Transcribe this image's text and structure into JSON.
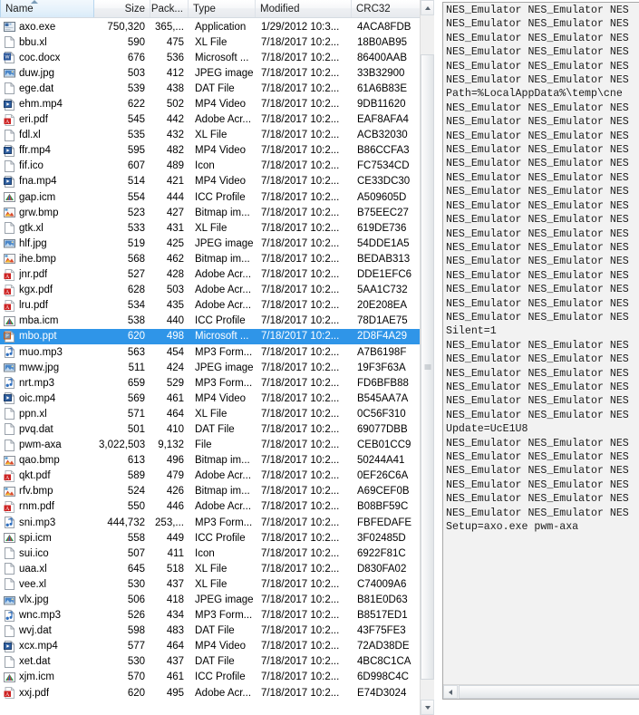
{
  "file_list": {
    "columns": [
      {
        "key": "name",
        "label": "Name",
        "sorted": true,
        "sort_dir": "asc"
      },
      {
        "key": "size",
        "label": "Size"
      },
      {
        "key": "packed",
        "label": "Pack..."
      },
      {
        "key": "type",
        "label": "Type"
      },
      {
        "key": "modified",
        "label": "Modified"
      },
      {
        "key": "crc32",
        "label": "CRC32"
      }
    ],
    "rows": [
      {
        "icon": "exe-icon",
        "name": "axo.exe",
        "size": "750,320",
        "packed": "365,...",
        "type": "Application",
        "modified": "1/29/2012 10:3...",
        "crc32": "4ACA8FDB",
        "selected": false
      },
      {
        "icon": "blank-icon",
        "name": "bbu.xl",
        "size": "590",
        "packed": "475",
        "type": "XL File",
        "modified": "7/18/2017 10:2...",
        "crc32": "18B0AB95",
        "selected": false
      },
      {
        "icon": "word-icon",
        "name": "coc.docx",
        "size": "676",
        "packed": "536",
        "type": "Microsoft ...",
        "modified": "7/18/2017 10:2...",
        "crc32": "86400AAB",
        "selected": false
      },
      {
        "icon": "image-icon",
        "name": "duw.jpg",
        "size": "503",
        "packed": "412",
        "type": "JPEG image",
        "modified": "7/18/2017 10:2...",
        "crc32": "33B32900",
        "selected": false
      },
      {
        "icon": "blank-icon",
        "name": "ege.dat",
        "size": "539",
        "packed": "438",
        "type": "DAT File",
        "modified": "7/18/2017 10:2...",
        "crc32": "61A6B83E",
        "selected": false
      },
      {
        "icon": "video-icon",
        "name": "ehm.mp4",
        "size": "622",
        "packed": "502",
        "type": "MP4 Video",
        "modified": "7/18/2017 10:2...",
        "crc32": "9DB11620",
        "selected": false
      },
      {
        "icon": "pdf-icon",
        "name": "eri.pdf",
        "size": "545",
        "packed": "442",
        "type": "Adobe Acr...",
        "modified": "7/18/2017 10:2...",
        "crc32": "EAF8AFA4",
        "selected": false
      },
      {
        "icon": "blank-icon",
        "name": "fdl.xl",
        "size": "535",
        "packed": "432",
        "type": "XL File",
        "modified": "7/18/2017 10:2...",
        "crc32": "ACB32030",
        "selected": false
      },
      {
        "icon": "video-icon",
        "name": "ffr.mp4",
        "size": "595",
        "packed": "482",
        "type": "MP4 Video",
        "modified": "7/18/2017 10:2...",
        "crc32": "B86CCFA3",
        "selected": false
      },
      {
        "icon": "blank-icon",
        "name": "fif.ico",
        "size": "607",
        "packed": "489",
        "type": "Icon",
        "modified": "7/18/2017 10:2...",
        "crc32": "FC7534CD",
        "selected": false
      },
      {
        "icon": "video-icon",
        "name": "fna.mp4",
        "size": "514",
        "packed": "421",
        "type": "MP4 Video",
        "modified": "7/18/2017 10:2...",
        "crc32": "CE33DC30",
        "selected": false
      },
      {
        "icon": "icc-icon",
        "name": "gap.icm",
        "size": "554",
        "packed": "444",
        "type": "ICC Profile",
        "modified": "7/18/2017 10:2...",
        "crc32": "A509605D",
        "selected": false
      },
      {
        "icon": "bitmap-icon",
        "name": "grw.bmp",
        "size": "523",
        "packed": "427",
        "type": "Bitmap im...",
        "modified": "7/18/2017 10:2...",
        "crc32": "B75EEC27",
        "selected": false
      },
      {
        "icon": "blank-icon",
        "name": "gtk.xl",
        "size": "533",
        "packed": "431",
        "type": "XL File",
        "modified": "7/18/2017 10:2...",
        "crc32": "619DE736",
        "selected": false
      },
      {
        "icon": "image-icon",
        "name": "hlf.jpg",
        "size": "519",
        "packed": "425",
        "type": "JPEG image",
        "modified": "7/18/2017 10:2...",
        "crc32": "54DDE1A5",
        "selected": false
      },
      {
        "icon": "bitmap-icon",
        "name": "ihe.bmp",
        "size": "568",
        "packed": "462",
        "type": "Bitmap im...",
        "modified": "7/18/2017 10:2...",
        "crc32": "BEDAB313",
        "selected": false
      },
      {
        "icon": "pdf-icon",
        "name": "jnr.pdf",
        "size": "527",
        "packed": "428",
        "type": "Adobe Acr...",
        "modified": "7/18/2017 10:2...",
        "crc32": "DDE1EFC6",
        "selected": false
      },
      {
        "icon": "pdf-icon",
        "name": "kgx.pdf",
        "size": "628",
        "packed": "503",
        "type": "Adobe Acr...",
        "modified": "7/18/2017 10:2...",
        "crc32": "5AA1C732",
        "selected": false
      },
      {
        "icon": "pdf-icon",
        "name": "lru.pdf",
        "size": "534",
        "packed": "435",
        "type": "Adobe Acr...",
        "modified": "7/18/2017 10:2...",
        "crc32": "20E208EA",
        "selected": false
      },
      {
        "icon": "icc-icon",
        "name": "mba.icm",
        "size": "538",
        "packed": "440",
        "type": "ICC Profile",
        "modified": "7/18/2017 10:2...",
        "crc32": "78D1AE75",
        "selected": false
      },
      {
        "icon": "ppt-icon",
        "name": "mbo.ppt",
        "size": "620",
        "packed": "498",
        "type": "Microsoft ...",
        "modified": "7/18/2017 10:2...",
        "crc32": "2D8F4A29",
        "selected": true
      },
      {
        "icon": "audio-icon",
        "name": "muo.mp3",
        "size": "563",
        "packed": "454",
        "type": "MP3 Form...",
        "modified": "7/18/2017 10:2...",
        "crc32": "A7B6198F",
        "selected": false
      },
      {
        "icon": "image-icon",
        "name": "mww.jpg",
        "size": "511",
        "packed": "424",
        "type": "JPEG image",
        "modified": "7/18/2017 10:2...",
        "crc32": "19F3F63A",
        "selected": false
      },
      {
        "icon": "audio-icon",
        "name": "nrt.mp3",
        "size": "659",
        "packed": "529",
        "type": "MP3 Form...",
        "modified": "7/18/2017 10:2...",
        "crc32": "FD6BFB88",
        "selected": false
      },
      {
        "icon": "video-icon",
        "name": "oic.mp4",
        "size": "569",
        "packed": "461",
        "type": "MP4 Video",
        "modified": "7/18/2017 10:2...",
        "crc32": "B545AA7A",
        "selected": false
      },
      {
        "icon": "blank-icon",
        "name": "ppn.xl",
        "size": "571",
        "packed": "464",
        "type": "XL File",
        "modified": "7/18/2017 10:2...",
        "crc32": "0C56F310",
        "selected": false
      },
      {
        "icon": "blank-icon",
        "name": "pvq.dat",
        "size": "501",
        "packed": "410",
        "type": "DAT File",
        "modified": "7/18/2017 10:2...",
        "crc32": "69077DBB",
        "selected": false
      },
      {
        "icon": "blank-icon",
        "name": "pwm-axa",
        "size": "3,022,503",
        "packed": "9,132",
        "type": "File",
        "modified": "7/18/2017 10:2...",
        "crc32": "CEB01CC9",
        "selected": false
      },
      {
        "icon": "bitmap-icon",
        "name": "qao.bmp",
        "size": "613",
        "packed": "496",
        "type": "Bitmap im...",
        "modified": "7/18/2017 10:2...",
        "crc32": "50244A41",
        "selected": false
      },
      {
        "icon": "pdf-icon",
        "name": "qkt.pdf",
        "size": "589",
        "packed": "479",
        "type": "Adobe Acr...",
        "modified": "7/18/2017 10:2...",
        "crc32": "0EF26C6A",
        "selected": false
      },
      {
        "icon": "bitmap-icon",
        "name": "rfv.bmp",
        "size": "524",
        "packed": "426",
        "type": "Bitmap im...",
        "modified": "7/18/2017 10:2...",
        "crc32": "A69CEF0B",
        "selected": false
      },
      {
        "icon": "pdf-icon",
        "name": "rnm.pdf",
        "size": "550",
        "packed": "446",
        "type": "Adobe Acr...",
        "modified": "7/18/2017 10:2...",
        "crc32": "B08BF59C",
        "selected": false
      },
      {
        "icon": "audio-icon",
        "name": "sni.mp3",
        "size": "444,732",
        "packed": "253,...",
        "type": "MP3 Form...",
        "modified": "7/18/2017 10:2...",
        "crc32": "FBFEDAFE",
        "selected": false
      },
      {
        "icon": "icc-icon",
        "name": "spi.icm",
        "size": "558",
        "packed": "449",
        "type": "ICC Profile",
        "modified": "7/18/2017 10:2...",
        "crc32": "3F02485D",
        "selected": false
      },
      {
        "icon": "blank-icon",
        "name": "sui.ico",
        "size": "507",
        "packed": "411",
        "type": "Icon",
        "modified": "7/18/2017 10:2...",
        "crc32": "6922F81C",
        "selected": false
      },
      {
        "icon": "blank-icon",
        "name": "uaa.xl",
        "size": "645",
        "packed": "518",
        "type": "XL File",
        "modified": "7/18/2017 10:2...",
        "crc32": "D830FA02",
        "selected": false
      },
      {
        "icon": "blank-icon",
        "name": "vee.xl",
        "size": "530",
        "packed": "437",
        "type": "XL File",
        "modified": "7/18/2017 10:2...",
        "crc32": "C74009A6",
        "selected": false
      },
      {
        "icon": "image-icon",
        "name": "vlx.jpg",
        "size": "506",
        "packed": "418",
        "type": "JPEG image",
        "modified": "7/18/2017 10:2...",
        "crc32": "B81E0D63",
        "selected": false
      },
      {
        "icon": "audio-icon",
        "name": "wnc.mp3",
        "size": "526",
        "packed": "434",
        "type": "MP3 Form...",
        "modified": "7/18/2017 10:2...",
        "crc32": "B8517ED1",
        "selected": false
      },
      {
        "icon": "blank-icon",
        "name": "wvj.dat",
        "size": "598",
        "packed": "483",
        "type": "DAT File",
        "modified": "7/18/2017 10:2...",
        "crc32": "43F75FE3",
        "selected": false
      },
      {
        "icon": "video-icon",
        "name": "xcx.mp4",
        "size": "577",
        "packed": "464",
        "type": "MP4 Video",
        "modified": "7/18/2017 10:2...",
        "crc32": "72AD38DE",
        "selected": false
      },
      {
        "icon": "blank-icon",
        "name": "xet.dat",
        "size": "530",
        "packed": "437",
        "type": "DAT File",
        "modified": "7/18/2017 10:2...",
        "crc32": "4BC8C1CA",
        "selected": false
      },
      {
        "icon": "icc-icon",
        "name": "xjm.icm",
        "size": "570",
        "packed": "461",
        "type": "ICC Profile",
        "modified": "7/18/2017 10:2...",
        "crc32": "6D998C4C",
        "selected": false
      },
      {
        "icon": "pdf-icon",
        "name": "xxj.pdf",
        "size": "620",
        "packed": "495",
        "type": "Adobe Acr...",
        "modified": "7/18/2017 10:2...",
        "crc32": "E74D3024",
        "selected": false
      }
    ]
  },
  "text_view": {
    "filler_line": "NES_Emulator NES_Emulator NES",
    "lines": [
      "NES_Emulator NES_Emulator NES",
      "NES_Emulator NES_Emulator NES",
      "NES_Emulator NES_Emulator NES",
      "NES_Emulator NES_Emulator NES",
      "NES_Emulator NES_Emulator NES",
      "NES_Emulator NES_Emulator NES",
      "Path=%LocalAppData%\\temp\\cne",
      "NES_Emulator NES_Emulator NES",
      "NES_Emulator NES_Emulator NES",
      "NES_Emulator NES_Emulator NES",
      "NES_Emulator NES_Emulator NES",
      "NES_Emulator NES_Emulator NES",
      "NES_Emulator NES_Emulator NES",
      "NES_Emulator NES_Emulator NES",
      "NES_Emulator NES_Emulator NES",
      "NES_Emulator NES_Emulator NES",
      "NES_Emulator NES_Emulator NES",
      "NES_Emulator NES_Emulator NES",
      "NES_Emulator NES_Emulator NES",
      "NES_Emulator NES_Emulator NES",
      "NES_Emulator NES_Emulator NES",
      "NES_Emulator NES_Emulator NES",
      "NES_Emulator NES_Emulator NES",
      "Silent=1",
      "NES_Emulator NES_Emulator NES",
      "NES_Emulator NES_Emulator NES",
      "NES_Emulator NES_Emulator NES",
      "NES_Emulator NES_Emulator NES",
      "NES_Emulator NES_Emulator NES",
      "NES_Emulator NES_Emulator NES",
      "Update=UcE1U8",
      "NES_Emulator NES_Emulator NES",
      "NES_Emulator NES_Emulator NES",
      "NES_Emulator NES_Emulator NES",
      "NES_Emulator NES_Emulator NES",
      "NES_Emulator NES_Emulator NES",
      "NES_Emulator NES_Emulator NES",
      "Setup=axo.exe pwm-axa"
    ]
  },
  "scrollbars": {
    "vertical_up": "scroll-up",
    "vertical_down": "scroll-down",
    "horizontal_left": "scroll-left"
  },
  "colors": {
    "selection": "#2f95e8",
    "selection_text": "#ffffff",
    "header_sorted": "#d9ebf9",
    "grid_line": "#e9edf1"
  }
}
